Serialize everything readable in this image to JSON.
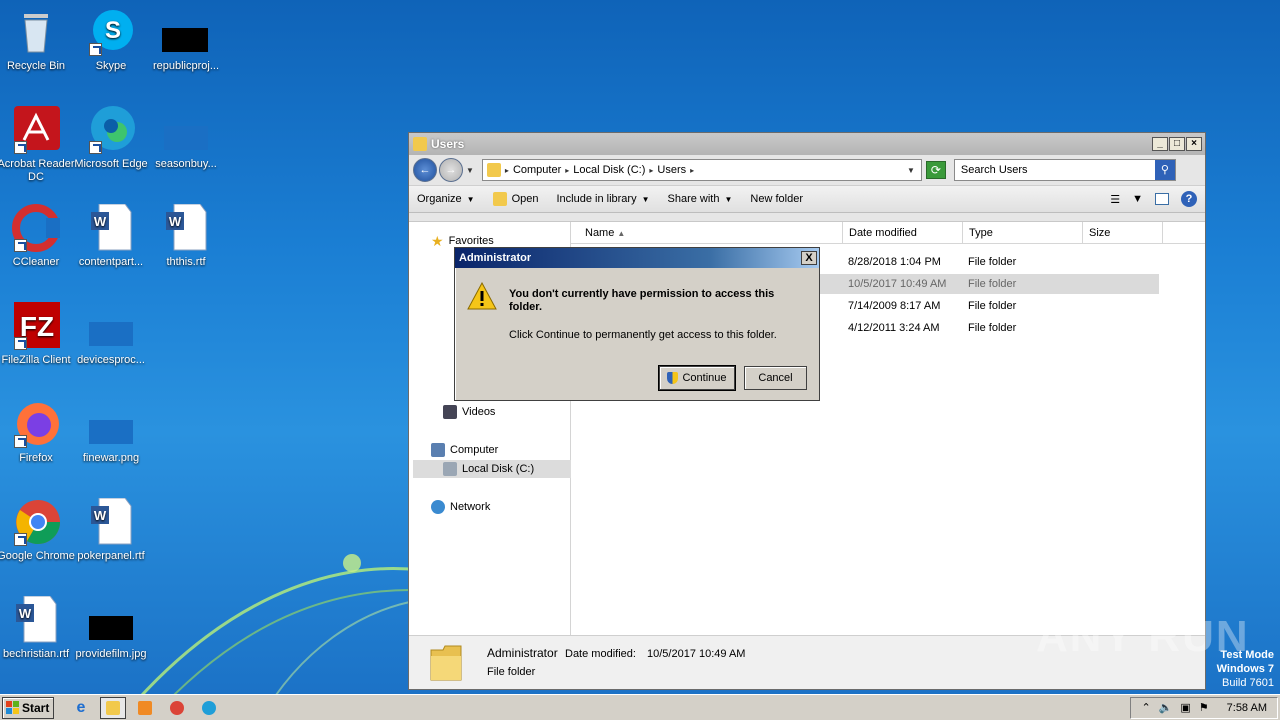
{
  "desktop": {
    "icons": [
      {
        "label": "Recycle Bin"
      },
      {
        "label": "Skype"
      },
      {
        "label": "republicproj..."
      },
      {
        "label": "Acrobat Reader DC"
      },
      {
        "label": "Microsoft Edge"
      },
      {
        "label": "seasonbuy..."
      },
      {
        "label": "CCleaner"
      },
      {
        "label": "contentpart..."
      },
      {
        "label": "ththis.rtf"
      },
      {
        "label": "FileZilla Client"
      },
      {
        "label": "devicesproc..."
      },
      {
        "label": "Firefox"
      },
      {
        "label": "finewar.png"
      },
      {
        "label": "Google Chrome"
      },
      {
        "label": "pokerpanel.rtf"
      },
      {
        "label": "bechristian.rtf"
      },
      {
        "label": "providefilm.jpg"
      }
    ]
  },
  "explorer": {
    "title": "Users",
    "breadcrumb": [
      "Computer",
      "Local Disk (C:)",
      "Users"
    ],
    "search_placeholder": "Search Users",
    "toolbar": {
      "organize": "Organize",
      "open": "Open",
      "include": "Include in library",
      "share": "Share with",
      "newfolder": "New folder"
    },
    "nav": {
      "favorites": "Favorites",
      "videos": "Videos",
      "computer": "Computer",
      "localdisk": "Local Disk (C:)",
      "network": "Network"
    },
    "columns": {
      "name": "Name",
      "date": "Date modified",
      "type": "Type",
      "size": "Size"
    },
    "rows": [
      {
        "date": "8/28/2018 1:04 PM",
        "type": "File folder"
      },
      {
        "date": "10/5/2017 10:49 AM",
        "type": "File folder"
      },
      {
        "date": "7/14/2009 8:17 AM",
        "type": "File folder"
      },
      {
        "date": "4/12/2011 3:24 AM",
        "type": "File folder"
      }
    ],
    "details": {
      "name": "Administrator",
      "date_label": "Date modified:",
      "date_value": "10/5/2017 10:49 AM",
      "type": "File folder"
    }
  },
  "dialog": {
    "title": "Administrator",
    "message": "You don't currently have permission to access this folder.",
    "sub": "Click Continue to permanently get access to this folder.",
    "continue": "Continue",
    "cancel": "Cancel",
    "close": "X"
  },
  "taskbar": {
    "start": "Start",
    "clock": "7:58 AM"
  },
  "watermark": {
    "line1": "Test Mode",
    "line2": "Windows 7",
    "line3": "Build 7601",
    "brand": "ANY RUN"
  }
}
